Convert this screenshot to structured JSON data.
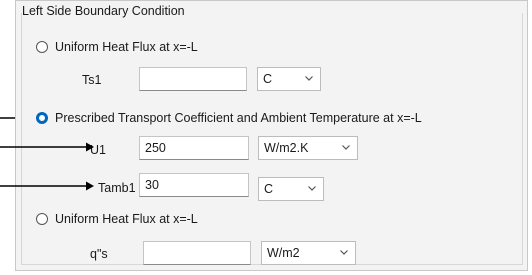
{
  "group_title": "Left Side Boundary Condition",
  "options": [
    {
      "label": "Uniform Heat Flux at x=-L",
      "checked": false,
      "field_label": "Ts1",
      "value": "",
      "unit": "C"
    },
    {
      "label": "Prescribed Transport Coefficient and Ambient Temperature at x=-L",
      "checked": true,
      "fields": [
        {
          "field_label": "U1",
          "value": "250",
          "unit": "W/m2.K"
        },
        {
          "field_label": "Tamb1",
          "value": "30",
          "unit": "C"
        }
      ]
    },
    {
      "label": "Uniform Heat Flux at x=-L",
      "checked": false,
      "field_label": "q\"s",
      "value": "",
      "unit": "W/m2"
    }
  ],
  "icons": {
    "dropdown": "chevron-down-icon",
    "pointer": "arrow-right-icon"
  },
  "colors": {
    "accent": "#0067c0",
    "panel": "#f3f3f3"
  }
}
